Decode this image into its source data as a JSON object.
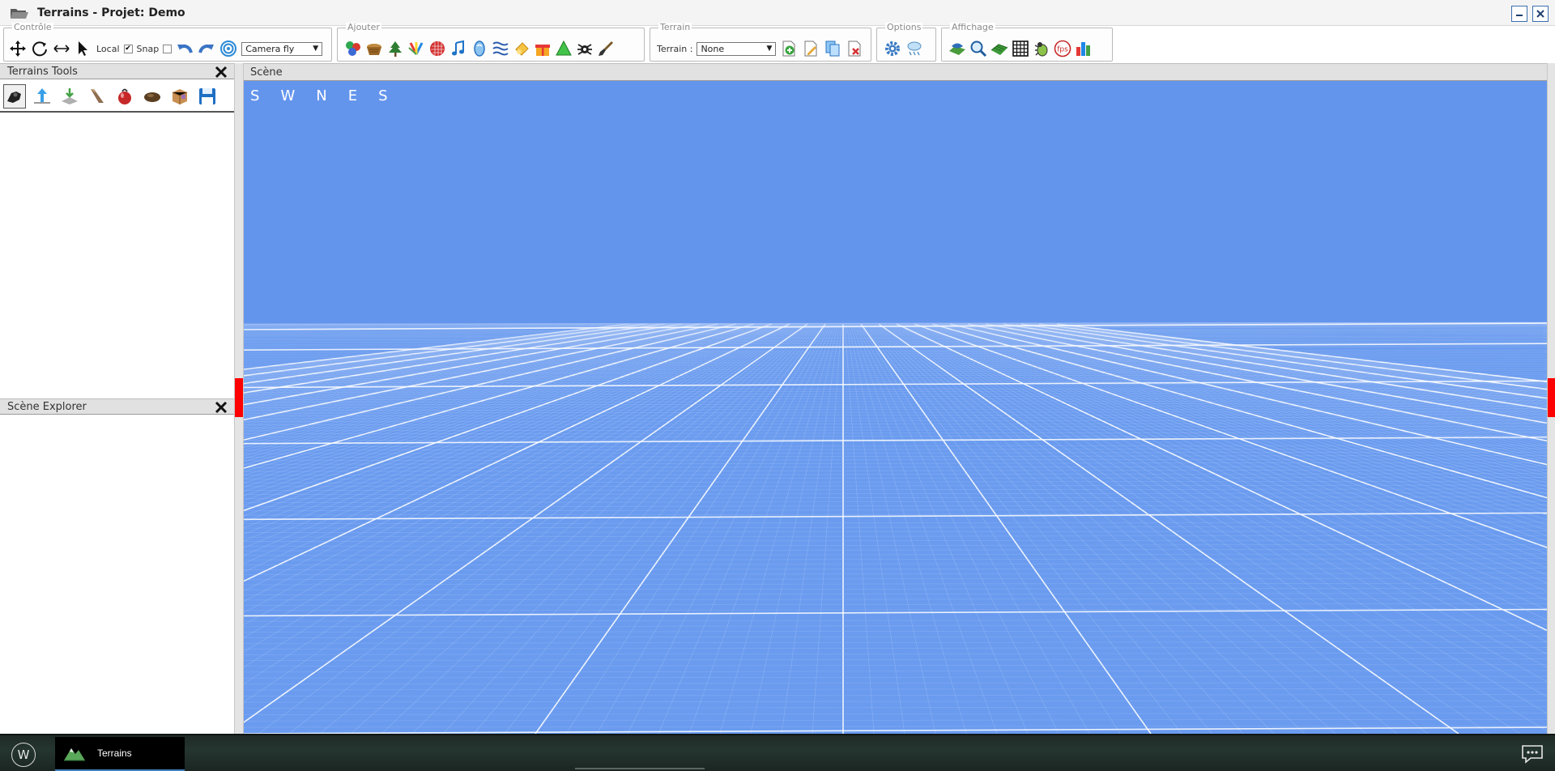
{
  "window": {
    "title": "Terrains - Projet: Demo",
    "icon": "open-folder-icon"
  },
  "toolbar": {
    "controle": {
      "label": "Contrôle",
      "local_label": "Local",
      "local_checked": true,
      "snap_label": "Snap",
      "snap_checked": false,
      "camera_select": "Camera fly"
    },
    "ajouter": {
      "label": "Ajouter"
    },
    "terrain": {
      "label": "Terrain",
      "terrain_label": "Terrain :",
      "terrain_select": "None"
    },
    "options": {
      "label": "Options"
    },
    "affichage": {
      "label": "Affichage",
      "fps_label": "fps"
    }
  },
  "panels": {
    "terrains_tools": {
      "title": "Terrains Tools"
    },
    "scene_explorer": {
      "title": "Scène Explorer"
    },
    "scene": {
      "title": "Scène"
    }
  },
  "viewport": {
    "compass": [
      "S",
      "W",
      "N",
      "E",
      "S"
    ],
    "sky_color": "#6495ed",
    "grid_color": "#a8c4f5"
  },
  "taskbar": {
    "start_label": "W",
    "task_label": "Terrains"
  }
}
